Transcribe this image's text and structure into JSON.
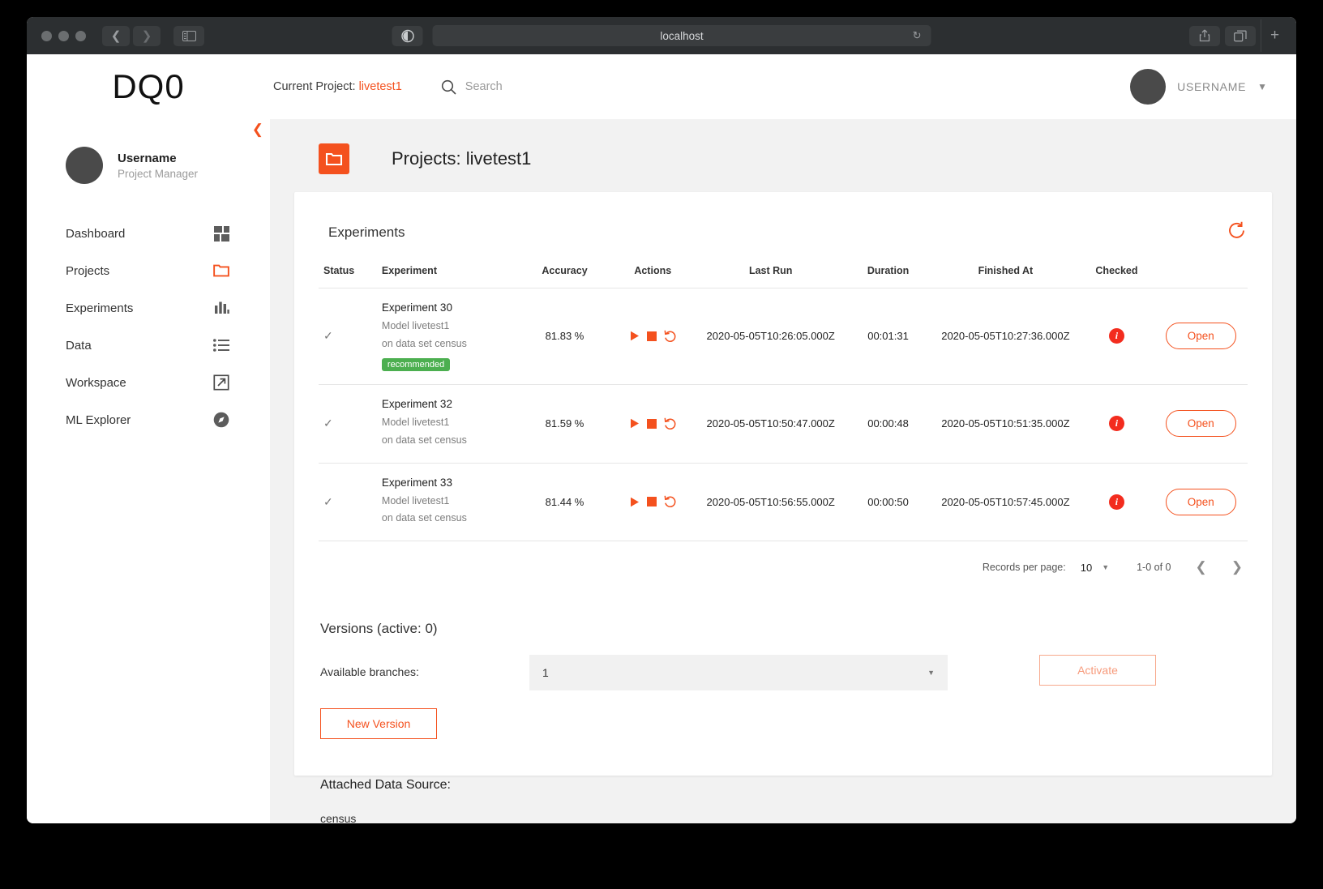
{
  "browser": {
    "url": "localhost",
    "back_icon": "chevron-left-icon",
    "forward_icon": "chevron-right-icon",
    "sidebar_icon": "sidebar-toggle-icon",
    "shield_icon": "privacy-report-icon",
    "reload_icon": "reload-icon",
    "share_icon": "share-icon",
    "tabs_icon": "tab-overview-icon",
    "new_tab_label": "+"
  },
  "header": {
    "logo": "DQ0",
    "current_project_label": "Current Project:",
    "current_project_value": "livetest1",
    "search_placeholder": "Search",
    "search_icon": "search-icon",
    "username": "USERNAME",
    "caret_icon": "chevron-down-icon"
  },
  "sidebar": {
    "collapse_icon": "chevron-left-icon",
    "profile": {
      "name": "Username",
      "role": "Project Manager"
    },
    "items": [
      {
        "label": "Dashboard",
        "icon": "dashboard-grid-icon"
      },
      {
        "label": "Projects",
        "icon": "folder-icon"
      },
      {
        "label": "Experiments",
        "icon": "bar-chart-icon"
      },
      {
        "label": "Data",
        "icon": "list-icon"
      },
      {
        "label": "Workspace",
        "icon": "external-link-icon"
      },
      {
        "label": "ML Explorer",
        "icon": "compass-icon"
      }
    ]
  },
  "page": {
    "title": "Projects: livetest1",
    "folder_icon": "folder-icon"
  },
  "experiments": {
    "card_title": "Experiments",
    "refresh_icon": "refresh-icon",
    "columns": [
      "Status",
      "Experiment",
      "Accuracy",
      "Actions",
      "Last Run",
      "Duration",
      "Finished At",
      "Checked"
    ],
    "rows": [
      {
        "status_icon": "check-icon",
        "name": "Experiment 30",
        "model": "Model livetest1",
        "dataset": "on data set census",
        "badge": "recommended",
        "accuracy": "81.83 %",
        "actions": [
          "play-icon",
          "stop-icon",
          "restart-icon"
        ],
        "last_run": "2020-05-05T10:26:05.000Z",
        "duration": "00:01:31",
        "finished_at": "2020-05-05T10:27:36.000Z",
        "checked_icon": "info-icon",
        "open_label": "Open"
      },
      {
        "status_icon": "check-icon",
        "name": "Experiment 32",
        "model": "Model livetest1",
        "dataset": "on data set census",
        "badge": "",
        "accuracy": "81.59 %",
        "actions": [
          "play-icon",
          "stop-icon",
          "restart-icon"
        ],
        "last_run": "2020-05-05T10:50:47.000Z",
        "duration": "00:00:48",
        "finished_at": "2020-05-05T10:51:35.000Z",
        "checked_icon": "info-icon",
        "open_label": "Open"
      },
      {
        "status_icon": "check-icon",
        "name": "Experiment 33",
        "model": "Model livetest1",
        "dataset": "on data set census",
        "badge": "",
        "accuracy": "81.44 %",
        "actions": [
          "play-icon",
          "stop-icon",
          "restart-icon"
        ],
        "last_run": "2020-05-05T10:56:55.000Z",
        "duration": "00:00:50",
        "finished_at": "2020-05-05T10:57:45.000Z",
        "checked_icon": "info-icon",
        "open_label": "Open"
      }
    ],
    "pagination": {
      "records_label": "Records per page:",
      "records_value": "10",
      "range": "1-0 of 0",
      "prev_icon": "chevron-left-icon",
      "next_icon": "chevron-right-icon"
    }
  },
  "versions": {
    "title": "Versions (active: 0)",
    "branches_label": "Available branches:",
    "branch_value": "1",
    "activate_label": "Activate",
    "new_version_label": "New Version"
  },
  "data_source": {
    "title": "Attached Data Source:",
    "value": "census"
  },
  "colors": {
    "accent": "#f4511e",
    "badge_green": "#4caf50",
    "info_red": "#f32c1e",
    "main_bg": "#f2f2f2"
  }
}
